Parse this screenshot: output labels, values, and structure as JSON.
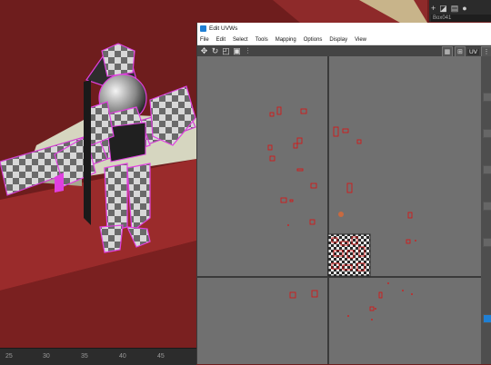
{
  "app": {
    "uv_window_title": "Edit UVWs",
    "object_name": "Box041"
  },
  "menu": {
    "file": "File",
    "edit": "Edit",
    "select": "Select",
    "tools": "Tools",
    "mapping": "Mapping",
    "options": "Options",
    "display": "Display",
    "view": "View"
  },
  "toolbar": {
    "uv_label": "UV",
    "icons": [
      "move-icon",
      "rotate-icon",
      "scale-icon",
      "freeform-icon",
      "mirror-icon",
      "checker-icon",
      "grid-icon"
    ]
  },
  "ruler": {
    "ticks": [
      "25",
      "30",
      "35",
      "40",
      "45"
    ]
  },
  "colors": {
    "viewport_bg": "#6e1d1d",
    "uv_bg": "#707070",
    "uv_selection": "#e01010",
    "wire_highlight": "#e040e0",
    "title_icon": "#1f7fd4"
  }
}
